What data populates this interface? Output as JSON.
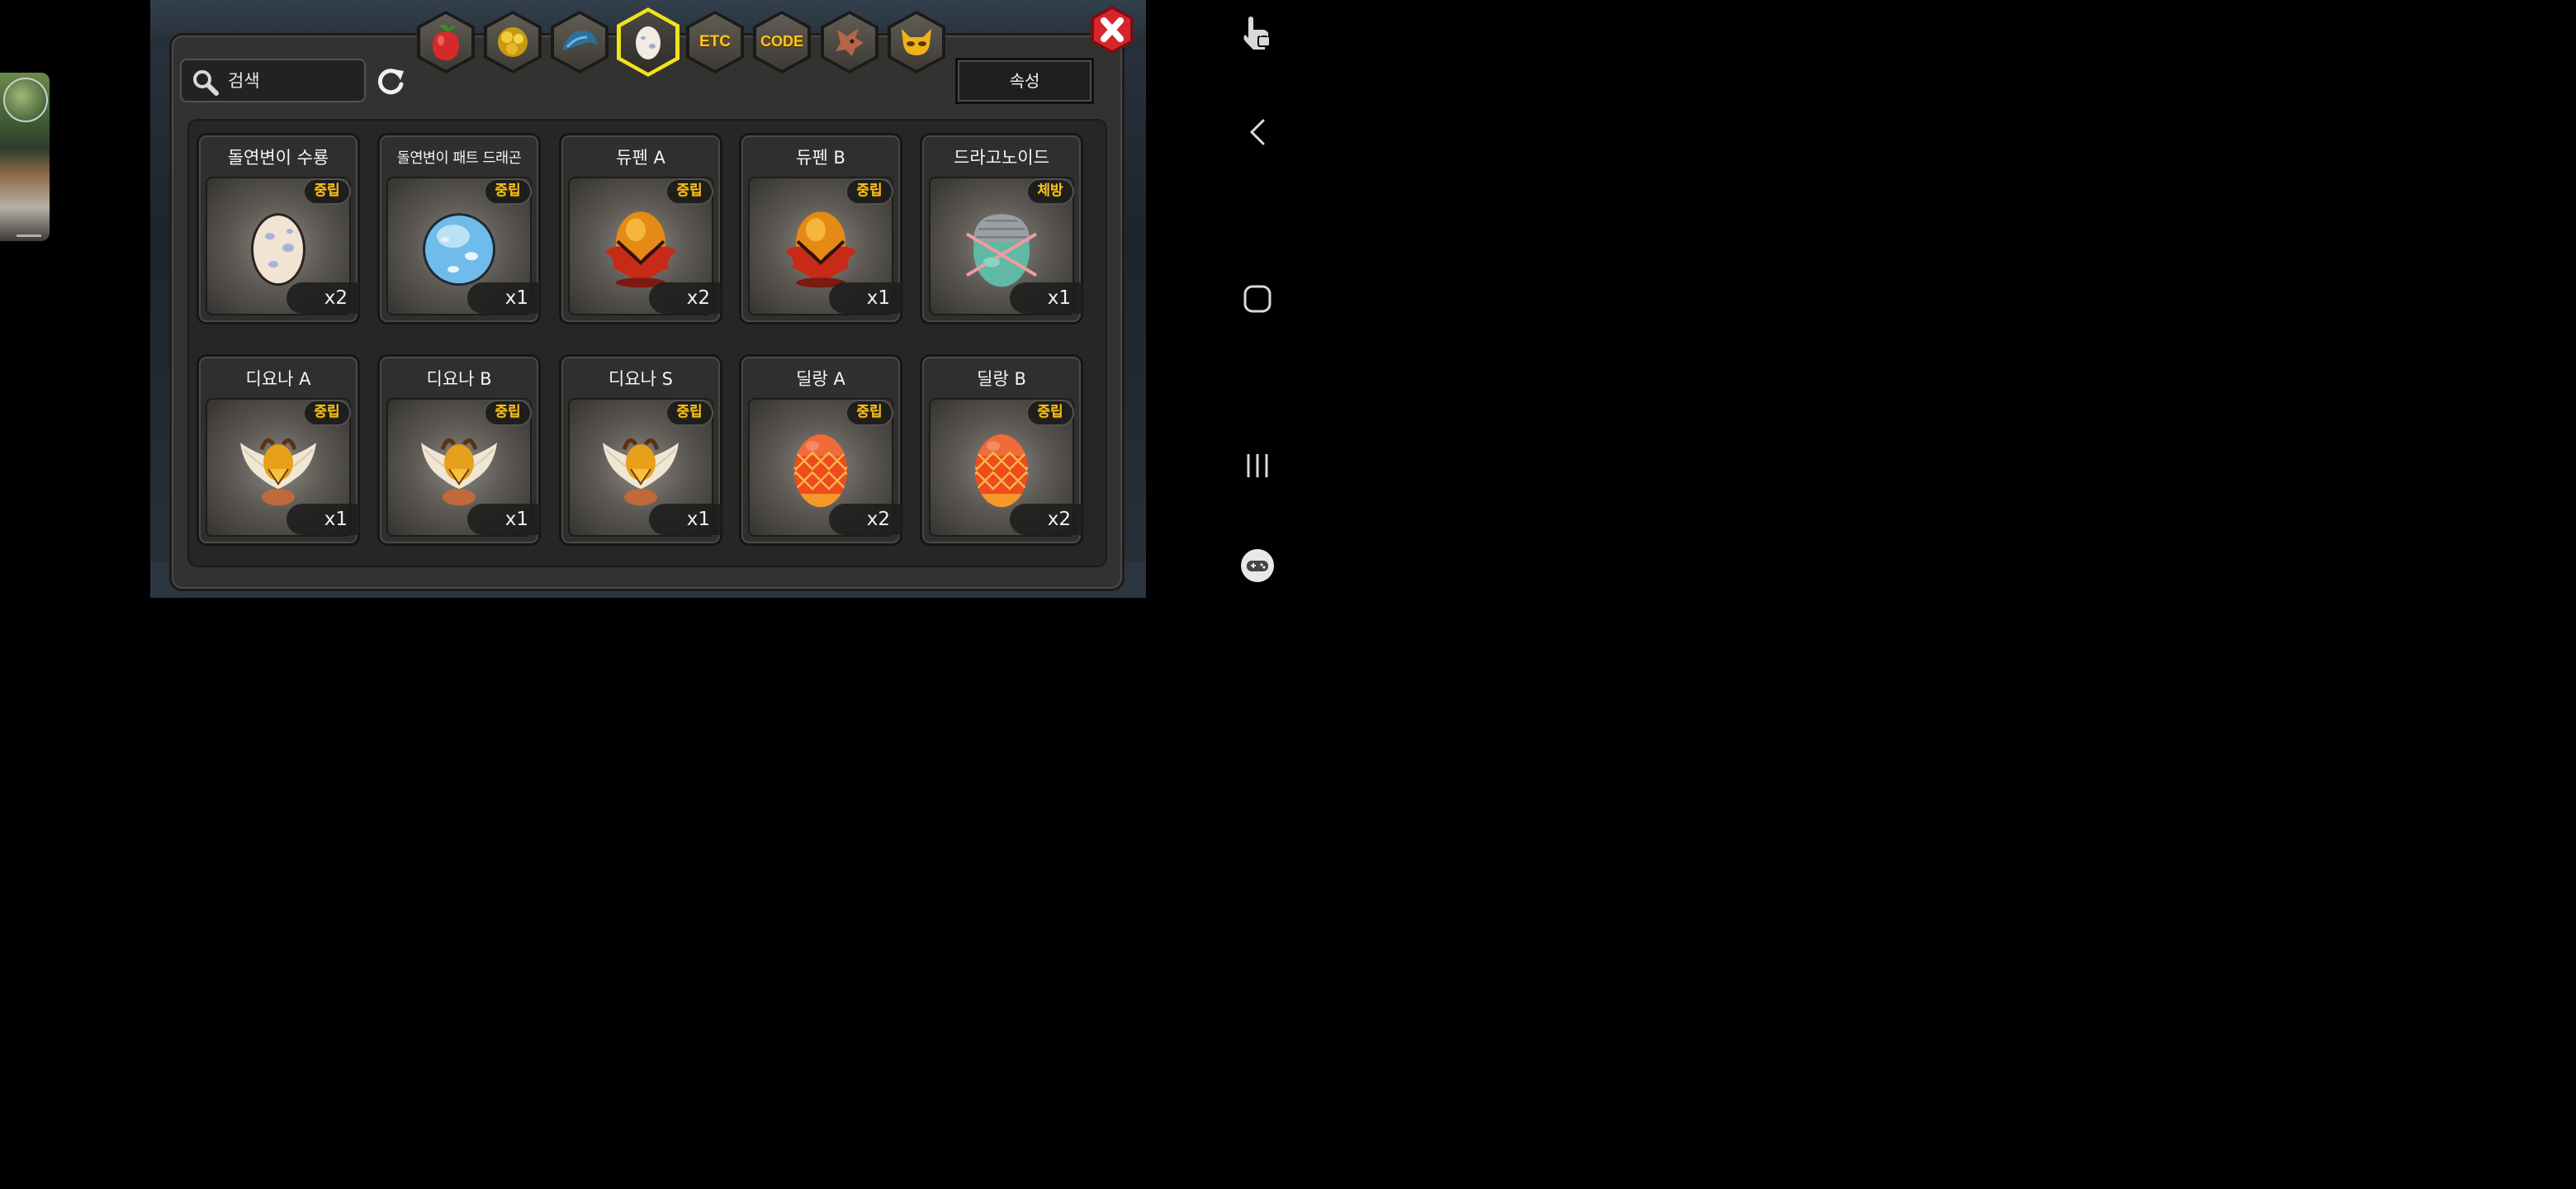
{
  "search": {
    "placeholder": "검색"
  },
  "tabs": [
    {
      "name": "fruit",
      "icon": "red-fruit-icon"
    },
    {
      "name": "gold-ore",
      "icon": "gold-ore-icon"
    },
    {
      "name": "blue-scale",
      "icon": "blue-scale-icon"
    },
    {
      "name": "egg",
      "icon": "egg-icon",
      "active": true
    },
    {
      "name": "etc",
      "label": "ETC"
    },
    {
      "name": "code",
      "label": "CODE"
    },
    {
      "name": "dragon",
      "icon": "dragon-head-icon"
    },
    {
      "name": "mask",
      "icon": "horned-mask-icon"
    }
  ],
  "attribute_button": "속성",
  "items": [
    {
      "name": "돌연변이 수룡",
      "badge": "중립",
      "qty": "x2",
      "egg": "spotted-white"
    },
    {
      "name": "돌연변이 패트 드래곤",
      "badge": "중립",
      "qty": "x1",
      "egg": "spotted-blue"
    },
    {
      "name": "듀펜 A",
      "badge": "중립",
      "qty": "x2",
      "egg": "flame-red"
    },
    {
      "name": "듀펜 B",
      "badge": "중립",
      "qty": "x1",
      "egg": "flame-red"
    },
    {
      "name": "드라고노이드",
      "badge": "체방",
      "qty": "x1",
      "egg": "metal-green"
    },
    {
      "name": "디요나 A",
      "badge": "중립",
      "qty": "x1",
      "egg": "winged-gold"
    },
    {
      "name": "디요나 B",
      "badge": "중립",
      "qty": "x1",
      "egg": "winged-gold"
    },
    {
      "name": "디요나 S",
      "badge": "중립",
      "qty": "x1",
      "egg": "winged-gold"
    },
    {
      "name": "딜랑 A",
      "badge": "중립",
      "qty": "x2",
      "egg": "diamond-orange"
    },
    {
      "name": "딜랑 B",
      "badge": "중립",
      "qty": "x2",
      "egg": "diamond-orange"
    }
  ],
  "colors": {
    "accent_yellow": "#f1e21a",
    "badge_text": "#f5c21c",
    "close_red": "#d6252b",
    "panel": "#323231"
  }
}
